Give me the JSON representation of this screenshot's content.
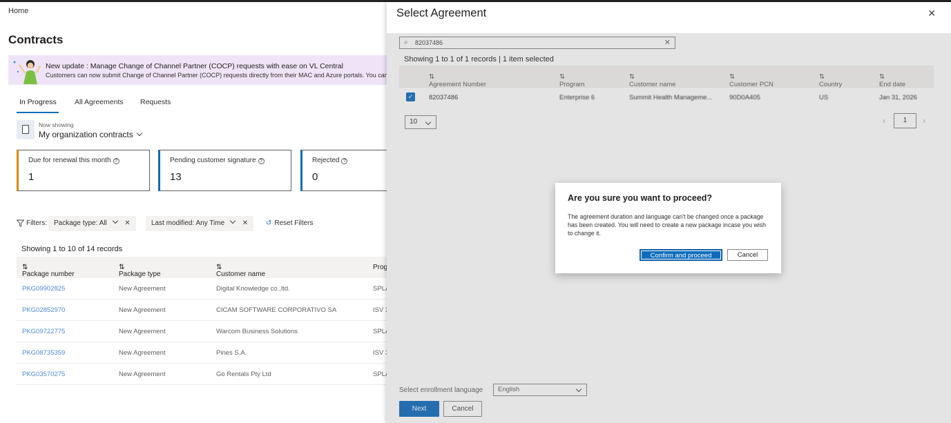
{
  "breadcrumb": {
    "home": "Home"
  },
  "page": {
    "title": "Contracts"
  },
  "banner": {
    "title": "New update : Manage Change of Channel Partner (COCP) requests with ease on VL Central",
    "text": "Customers can now submit Change of Channel Partner (COCP) requests directly from their MAC and Azure portals. You can conve"
  },
  "tabs": [
    "In Progress",
    "All Agreements",
    "Requests"
  ],
  "now_showing": {
    "label": "Now showing",
    "value": "My organization contracts"
  },
  "cards": [
    {
      "label": "Due for renewal this month",
      "value": "1"
    },
    {
      "label": "Pending customer signature",
      "value": "13"
    },
    {
      "label": "Rejected",
      "value": "0"
    }
  ],
  "filters": {
    "label": "Filters:",
    "package_type": "Package type:",
    "package_type_value": "All",
    "last_modified": "Last modified: Any Time",
    "reset": "Reset Filters"
  },
  "left_table": {
    "records": "Showing 1 to 10 of 14 records",
    "headers": [
      "Package number",
      "Package type",
      "Customer name",
      "Prog"
    ],
    "rows": [
      [
        "PKG09902825",
        "New Agreement",
        "Digital Knowledge co.,ltd.",
        "SPLA"
      ],
      [
        "PKG02852970",
        "New Agreement",
        "CICAM SOFTWARE CORPORATIVO SA",
        "ISV 3"
      ],
      [
        "PKG09722775",
        "New Agreement",
        "Warcom Business Solutions",
        "SPLA"
      ],
      [
        "PKG08735359",
        "New Agreement",
        "Pines S.A.",
        "ISV 3"
      ],
      [
        "PKG03570275",
        "New Agreement",
        "Go Rentals Pty Ltd",
        "SPLA"
      ]
    ]
  },
  "panel": {
    "title": "Select Agreement",
    "close_icon": "close-icon",
    "search_value": "82037486",
    "records": "Showing 1 to 1 of 1 records | 1 item selected",
    "headers": [
      "Agreement Number",
      "Program",
      "Customer name",
      "Customer PCN",
      "Country",
      "End date"
    ],
    "row": [
      "82037486",
      "Enterprise 6",
      "Summit Health Manageme...",
      "90D0A405",
      "US",
      "Jan 31, 2026"
    ],
    "page_size": "10",
    "current_page": "1",
    "lang_label": "Select enrollment language",
    "lang_value": "English",
    "next": "Next",
    "cancel": "Cancel"
  },
  "dialog": {
    "title": "Are you sure you want to proceed?",
    "body": "The agreement duration and language can't be changed once a package has been created. You will need to create a new package incase you wish to change it.",
    "confirm": "Confirm and proceed",
    "cancel": "Cancel"
  },
  "colors": {
    "accent": "#0f6cbd",
    "renewal": "#e08a00",
    "banner_bg": "#efe4f7"
  }
}
